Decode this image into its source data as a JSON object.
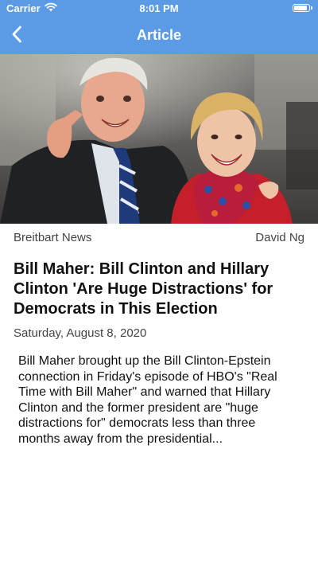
{
  "status_bar": {
    "carrier": "Carrier",
    "time": "8:01 PM",
    "battery_level": 1.0
  },
  "nav": {
    "title": "Article",
    "back_icon": "chevron-left-icon"
  },
  "colors": {
    "nav_background": "#5b9be6",
    "nav_text": "#ffffff"
  },
  "article": {
    "source": "Breitbart News",
    "author": "David Ng",
    "title": "Bill Maher: Bill Clinton and Hillary Clinton 'Are Huge Distractions' for Democrats in This Election",
    "date": "Saturday, August 8, 2020",
    "summary": "Bill Maher brought up the Bill Clinton-Epstein connection in Friday's episode of HBO's \"Real Time with Bill Maher\" and warned that Hillary Clinton and the former president are \"huge distractions for\" democrats less than three months away from the presidential..."
  }
}
